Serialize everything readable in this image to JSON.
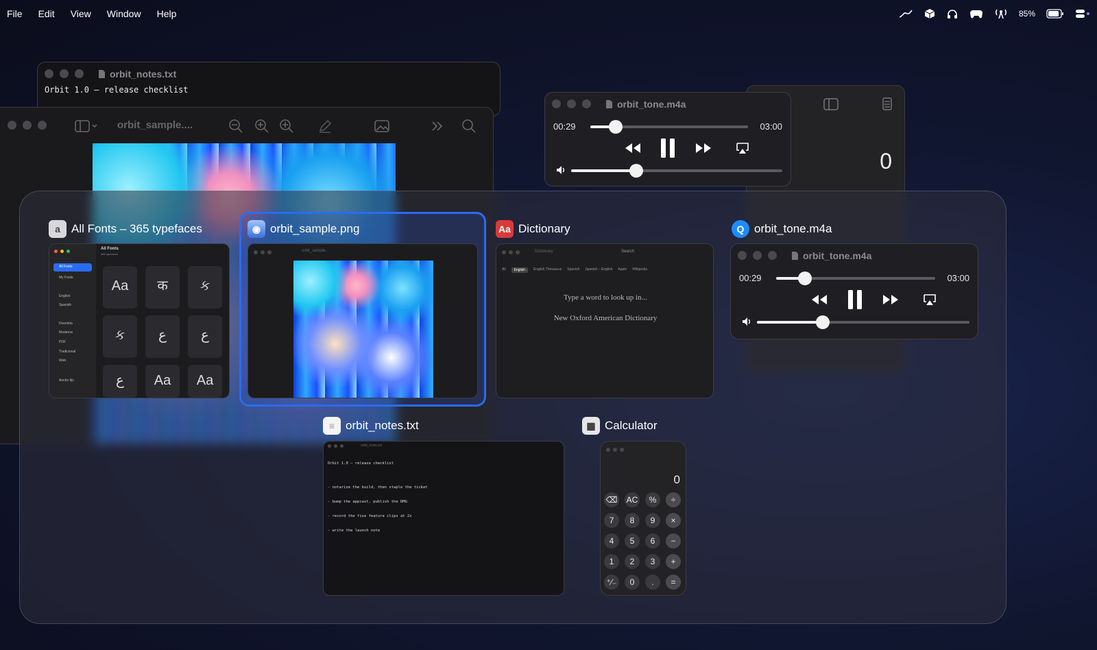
{
  "menubar": {
    "items": [
      "File",
      "Edit",
      "View",
      "Window",
      "Help"
    ],
    "battery": "85%"
  },
  "bg_notes": {
    "title": "orbit_notes.txt",
    "line1": "Orbit 1.0 — release checklist"
  },
  "bg_preview": {
    "title": "orbit_sample...."
  },
  "bg_player": {
    "title": "orbit_tone.m4a",
    "elapsed": "00:29",
    "total": "03:00",
    "progress": 0.16,
    "volume": 0.31
  },
  "bg_calc": {
    "display": "0"
  },
  "switcher": {
    "fonts": {
      "label": "All Fonts – 365 typefaces",
      "header_title": "All Fonts",
      "header_sub": "365 typefaces",
      "side_items": [
        "All Fonts",
        "My Fonts",
        "English",
        "Spanish",
        "Divertida",
        "Moderna",
        "PDF",
        "Tradicional",
        "Web",
        "Ancho fijo"
      ],
      "glyphs": [
        "Aa",
        "क",
        "ક",
        "ક",
        "ع",
        "ع",
        "ع",
        "Aa",
        "Aa"
      ]
    },
    "preview": {
      "label": "orbit_sample.png",
      "title": "orbit_sample..."
    },
    "dictionary": {
      "label": "Dictionary",
      "title": "Dictionary",
      "search": "Search",
      "tabs": [
        "All",
        "English",
        "English Thesaurus",
        "Spanish",
        "Spanish – English",
        "Apple",
        "Wikipedia"
      ],
      "prompt": "Type a word to look up in...",
      "dict_name": "New Oxford American Dictionary"
    },
    "player": {
      "label": "orbit_tone.m4a",
      "title": "orbit_tone.m4a",
      "elapsed": "00:29",
      "total": "03:00",
      "progress": 0.18,
      "volume": 0.31
    },
    "notes": {
      "label": "orbit_notes.txt",
      "title": "orbit_notes.txt",
      "lines": [
        "Orbit 1.0 — release checklist",
        "",
        "- notarize the build, then staple the ticket",
        "- bump the appcast, publish the DMG",
        "- record the five feature clips at 2x",
        "- write the launch note"
      ]
    },
    "calculator": {
      "label": "Calculator",
      "display": "0",
      "keys": [
        "⌫",
        "AC",
        "%",
        "÷",
        "7",
        "8",
        "9",
        "×",
        "4",
        "5",
        "6",
        "−",
        "1",
        "2",
        "3",
        "+",
        "⁺∕₋",
        "0",
        ".",
        "="
      ]
    }
  },
  "colors": {
    "accent": "#2a6cf0",
    "dict_red": "#d83a3a",
    "qt_blue": "#1e8cff"
  }
}
